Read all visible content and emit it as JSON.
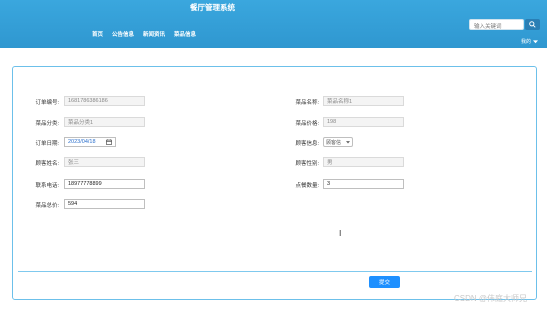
{
  "header": {
    "site_title": "餐厅管理系统",
    "nav": [
      "首页",
      "公告信息",
      "新闻资讯",
      "菜品信息"
    ],
    "search_placeholder": "输入关键词",
    "user_label": "我的"
  },
  "form": {
    "order_no_label": "订单编号:",
    "order_no_value": "1681786386186",
    "dish_name_label": "菜品名称:",
    "dish_name_value": "菜品名称1",
    "dish_category_label": "菜品分类:",
    "dish_category_value": "菜品分类1",
    "dish_price_label": "菜品价格:",
    "dish_price_value": "198",
    "order_date_label": "订单日期:",
    "order_date_value": "2023/04/18",
    "customer_info_label": "顾客信息:",
    "customer_info_value": "顾客信",
    "customer_name_label": "顾客姓名:",
    "customer_name_value": "张三",
    "customer_gender_label": "顾客性别:",
    "customer_gender_value": "男",
    "phone_label": "联系电话:",
    "phone_value": "18977778899",
    "quantity_label": "点餐数量:",
    "quantity_value": "3",
    "total_label": "菜品总价:",
    "total_value": "594",
    "remark_label": "点餐备注:",
    "remark_value": ""
  },
  "submit_label": "提交",
  "watermark": "CSDN @伟庭大师兄"
}
